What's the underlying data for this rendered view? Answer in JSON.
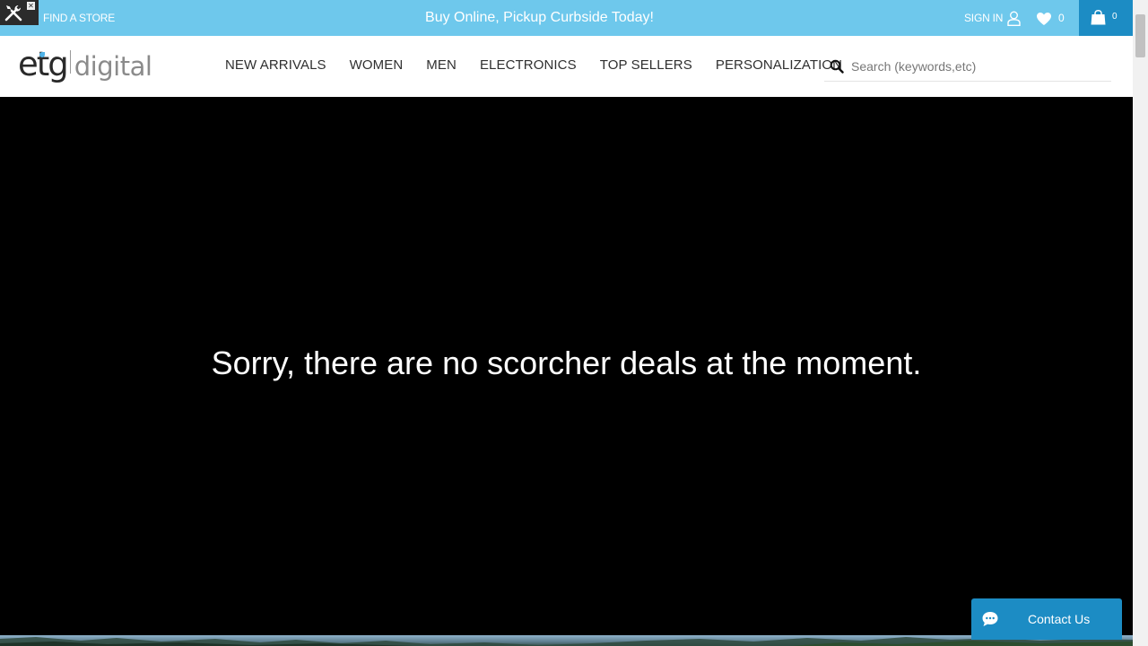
{
  "topbar": {
    "find_store": "FIND A STORE",
    "promo": "Buy Online, Pickup Curbside Today!",
    "sign_in": "SIGN IN",
    "wishlist_count": "0",
    "cart_count": "0"
  },
  "tools_widget": {
    "close_glyph": "✕"
  },
  "logo": {
    "part1": "etg",
    "part2": "digital"
  },
  "nav": {
    "items": [
      {
        "label": "NEW ARRIVALS"
      },
      {
        "label": "WOMEN"
      },
      {
        "label": "MEN"
      },
      {
        "label": "ELECTRONICS"
      },
      {
        "label": "TOP SELLERS"
      },
      {
        "label": "PERSONALIZATION"
      }
    ]
  },
  "search": {
    "placeholder": "Search (keywords,etc)",
    "value": ""
  },
  "hero": {
    "message": "Sorry, there are no scorcher deals at the moment."
  },
  "contact": {
    "label": "Contact Us"
  },
  "colors": {
    "topbar": "#6ec8ec",
    "accent": "#1c8cc4",
    "hero_bg": "#000000"
  },
  "icons": [
    "wrench-screwdriver-icon",
    "close-icon",
    "user-icon",
    "heart-icon",
    "shopping-bag-icon",
    "search-icon",
    "chat-bubble-icon"
  ]
}
